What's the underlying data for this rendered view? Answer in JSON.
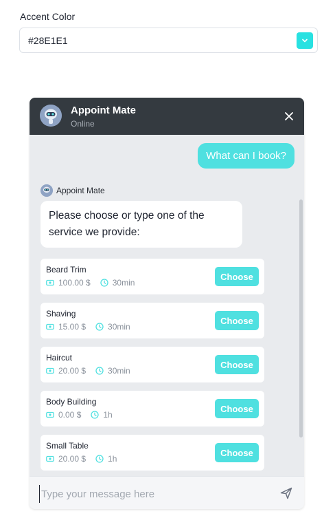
{
  "accent": {
    "label": "Accent Color",
    "value": "#28E1E1"
  },
  "colors": {
    "accent": "#28E1E1",
    "header": "#343a40",
    "chat_bg": "#e9ebee"
  },
  "chat": {
    "header": {
      "bot_name": "Appoint Mate",
      "status": "Online",
      "close_icon": "close-icon"
    },
    "user_message": "What can I book?",
    "bot": {
      "name": "Appoint Mate",
      "message": "Please choose or type one of the service we provide:"
    },
    "services": [
      {
        "name": "Beard Trim",
        "price": "100.00 $",
        "duration": "30min",
        "button": "Choose"
      },
      {
        "name": "Shaving",
        "price": "15.00 $",
        "duration": "30min",
        "button": "Choose"
      },
      {
        "name": "Haircut",
        "price": "20.00 $",
        "duration": "30min",
        "button": "Choose"
      },
      {
        "name": "Body Building",
        "price": "0.00 $",
        "duration": "1h",
        "button": "Choose"
      },
      {
        "name": "Small Table",
        "price": "20.00 $",
        "duration": "1h",
        "button": "Choose"
      }
    ],
    "input": {
      "placeholder": "Type your message here",
      "send_icon": "send-icon"
    }
  }
}
